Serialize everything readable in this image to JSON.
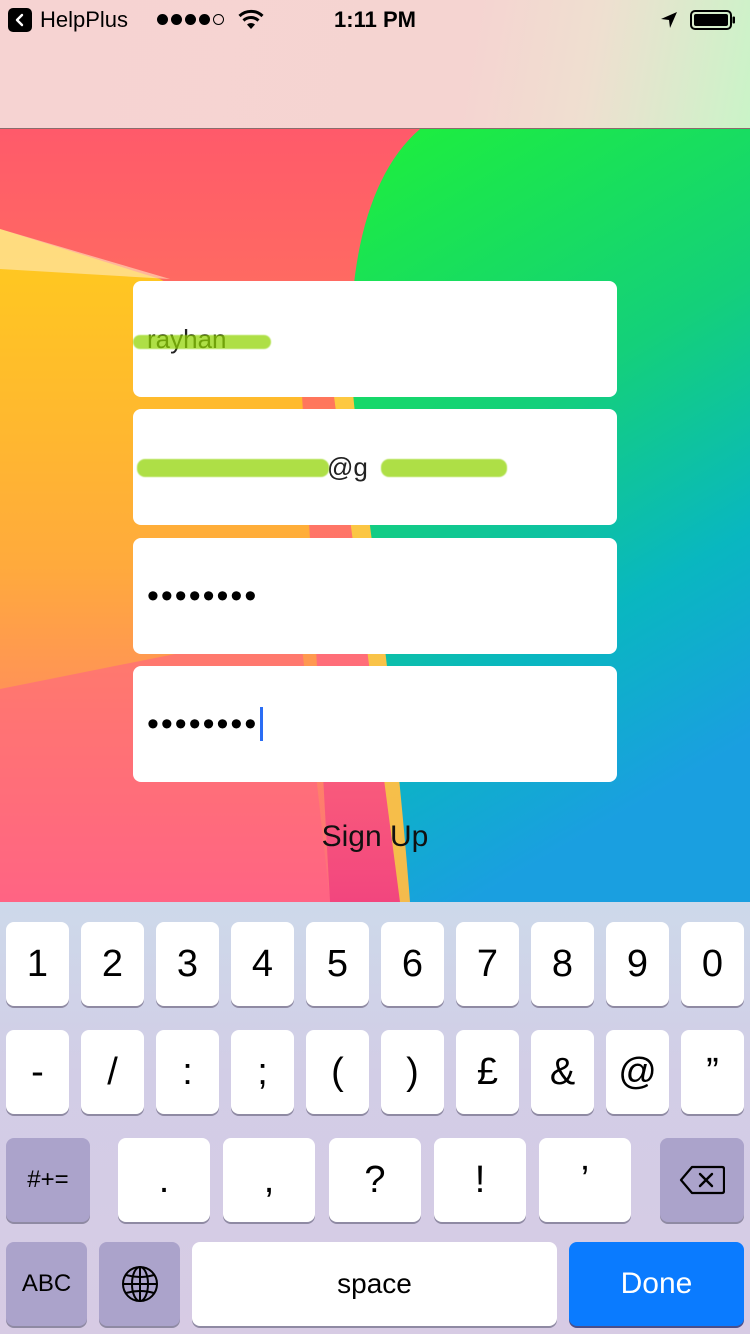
{
  "status_bar": {
    "back_app": "HelpPlus",
    "time": "1:11 PM"
  },
  "form": {
    "name_value": "rayhan",
    "email_value": "@g",
    "password_mask": "••••••••",
    "confirm_password_mask": "••••••••",
    "signup_label": "Sign Up"
  },
  "keyboard": {
    "row1": [
      "1",
      "2",
      "3",
      "4",
      "5",
      "6",
      "7",
      "8",
      "9",
      "0"
    ],
    "row2": [
      "-",
      "/",
      ":",
      ";",
      "(",
      ")",
      "£",
      "&",
      "@",
      "”"
    ],
    "row3": [
      ".",
      ",",
      "?",
      "!",
      "’"
    ],
    "symbols_toggle": "#+=",
    "abc_toggle": "ABC",
    "space": "space",
    "done": "Done"
  },
  "colors": {
    "done_blue": "#0a7bff",
    "caret_blue": "#2a6df4",
    "top_bar_pink": "#f6d3d2"
  }
}
